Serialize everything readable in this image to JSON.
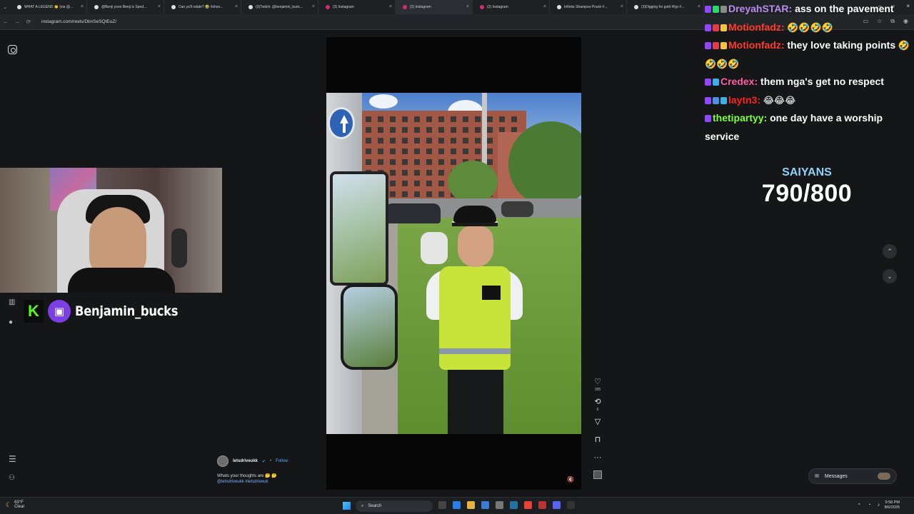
{
  "browser": {
    "tabs": [
      {
        "label": "WHAT A LEGEND 👏 (via @...",
        "color": "#111",
        "active": false
      },
      {
        "label": "@Benji yooo Benji is Sped...",
        "color": "#111",
        "active": false
      },
      {
        "label": "Can ya'll relate? 🤣 #shoo...",
        "color": "#111",
        "active": false
      },
      {
        "label": "(3)Twitch: @benjamin_buck...",
        "color": "#111",
        "active": false
      },
      {
        "label": "(3) Instagram",
        "color": "#d62976",
        "active": false
      },
      {
        "label": "(2) Instagram",
        "color": "#d62976",
        "active": true
      },
      {
        "label": "(2) Instagram",
        "color": "#d62976",
        "active": false
      },
      {
        "label": "Infinite Shampoo Prank #...",
        "color": "#111",
        "active": false
      },
      {
        "label": "(3)Digging for gold #fyp #...",
        "color": "#111",
        "active": false
      }
    ],
    "url": "instagram.com/reels/DbnSeSQtEuZ/",
    "nav_back": "←",
    "nav_forward": "→",
    "nav_reload": "⟳",
    "tab_menu": "⌄",
    "close_glyph": "×"
  },
  "stream": {
    "kick_letter": "K",
    "twitch_glyph": "▣",
    "streamer_name": "Benjamin_bucks"
  },
  "reel": {
    "likes": "395",
    "reposts": "6",
    "author": "letsdriveukk",
    "verified_glyph": "✔",
    "follow_label": "Follow",
    "caption_text": "Whats your thoughts are 🤔 🤔",
    "caption_tags": "@letsdriveukk #letsdriveuk",
    "mute_glyph": "🔇",
    "icons": {
      "like": "♡",
      "repost": "⟲",
      "share": "▽",
      "save": "⊓",
      "more": "···"
    }
  },
  "chat": {
    "messages": [
      {
        "user": "DreyahSTAR:",
        "user_color": "#b98bf0",
        "badges": [
          "#9146ff",
          "#2bd96b",
          "#8a8a8a"
        ],
        "text": " ass on the pavement",
        "emotes": ""
      },
      {
        "user": "Motionfadz:",
        "user_color": "#ff3a2b",
        "badges": [
          "#9146ff",
          "#e23b4a",
          "#f5c542"
        ],
        "text": "",
        "emotes": " 🤣🤣🤣🤣"
      },
      {
        "user": "Motionfadz:",
        "user_color": "#ff3a2b",
        "badges": [
          "#9146ff",
          "#e23b4a",
          "#f5c542"
        ],
        "text": " they love taking points",
        "emotes": " 🤣🤣🤣🤣"
      },
      {
        "user": "Credex:",
        "user_color": "#ff5aa3",
        "badges": [
          "#9146ff",
          "#38b2e8"
        ],
        "text": " them nga's get no respect",
        "emotes": ""
      },
      {
        "user": "laytn3:",
        "user_color": "#ff2020",
        "badges": [
          "#9146ff",
          "#4e8fe0",
          "#38b2e8"
        ],
        "text": "",
        "emotes": " 😂😂😂"
      },
      {
        "user": "thetipartyy:",
        "user_color": "#7cff3a",
        "badges": [
          "#9146ff"
        ],
        "text": " one day have a worship service",
        "emotes": ""
      }
    ]
  },
  "goal": {
    "label": "SAIYANS",
    "count": "790/800"
  },
  "nav": {
    "up_glyph": "⌃",
    "down_glyph": "⌄"
  },
  "messages_widget": {
    "label": "Messages"
  },
  "taskbar": {
    "temperature": "63°F",
    "weather_status": "Clear",
    "search_placeholder": "Search",
    "time": "9:58 PM",
    "date": "8/6/2026"
  }
}
